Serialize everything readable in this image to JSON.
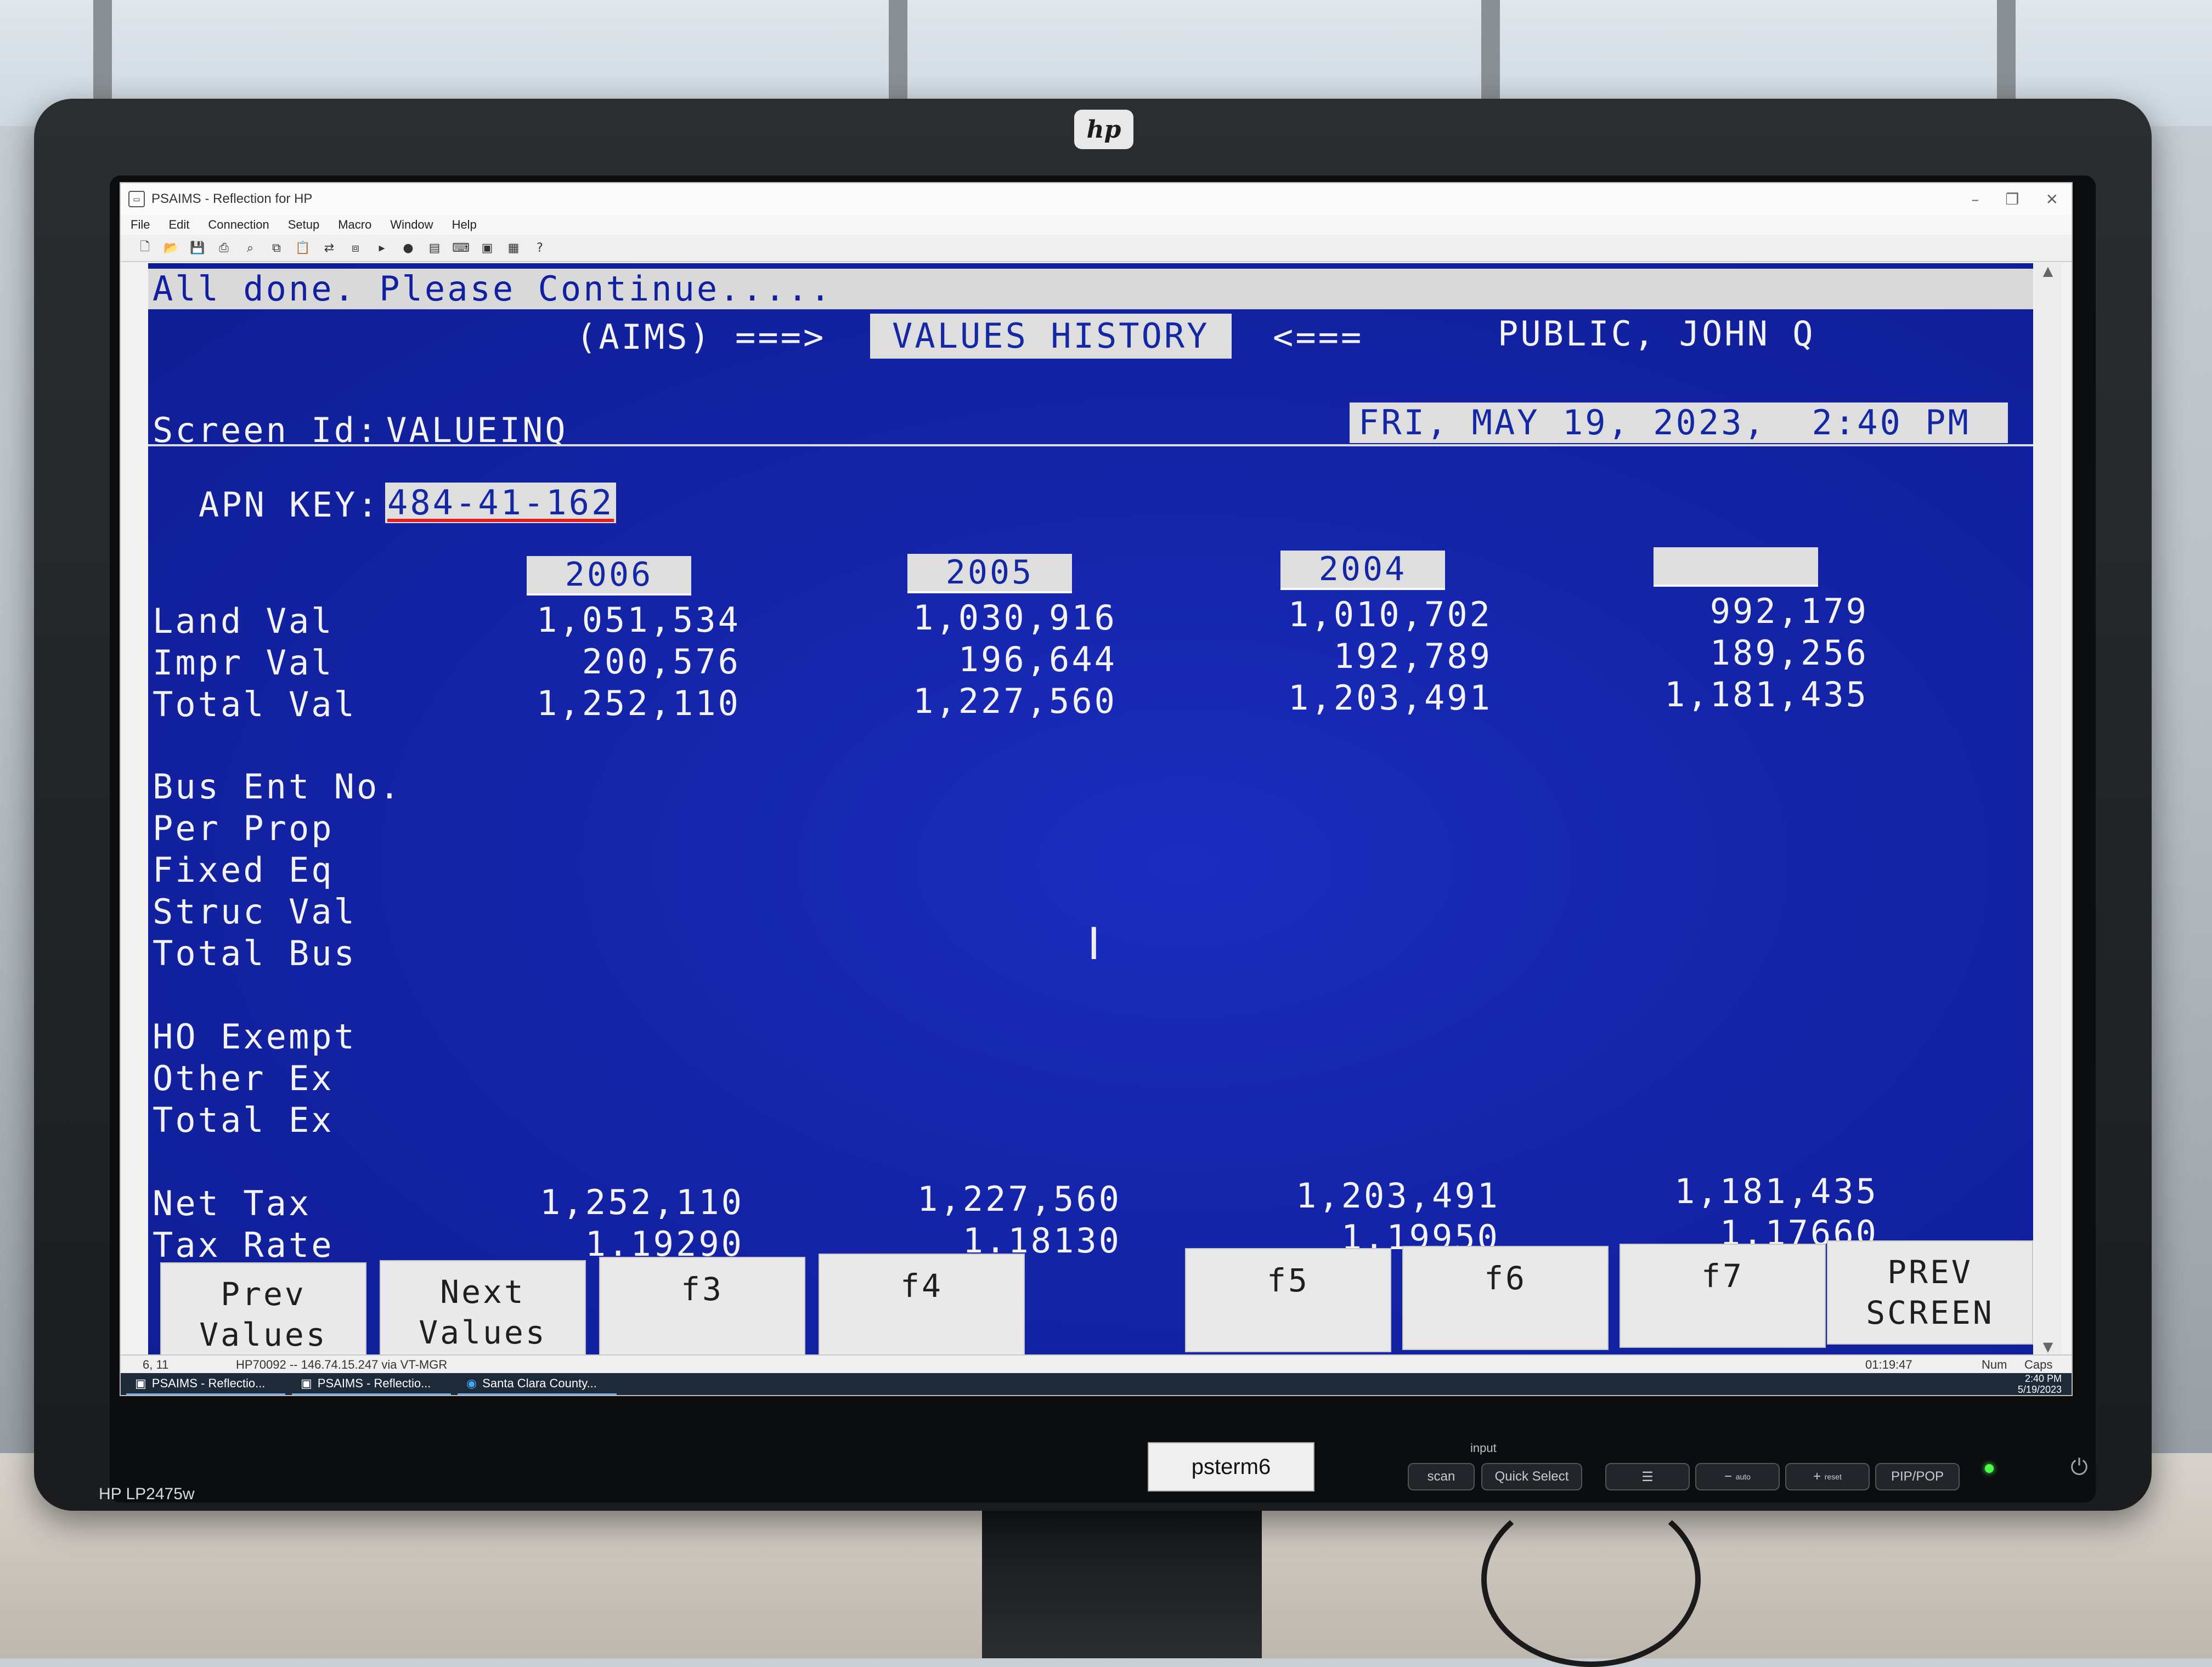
{
  "monitor": {
    "brand": "hp",
    "model": "HP LP2475w",
    "asset_tag": "psterm6",
    "osd": {
      "input_label": "input",
      "scan": "scan",
      "quick_select": "Quick Select",
      "menu": "☰",
      "minus": "−",
      "auto": "auto",
      "plus": "+",
      "reset": "reset",
      "pip": "PIP/POP",
      "power": "⏻"
    }
  },
  "window": {
    "title": "PSAIMS - Reflection for HP",
    "controls": {
      "minimize": "–",
      "restore": "❐",
      "close": "✕"
    },
    "menu": [
      "File",
      "Edit",
      "Connection",
      "Setup",
      "Macro",
      "Window",
      "Help"
    ]
  },
  "terminal": {
    "status_message": "All done.  Please Continue.....",
    "system": "(AIMS)",
    "arrow_right": "===>",
    "screen_title": "VALUES HISTORY",
    "arrow_left": "<===",
    "owner_name": "PUBLIC, JOHN Q",
    "screen_id_label": "Screen Id:",
    "screen_id": "VALUEINQ",
    "datetime": "FRI, MAY 19, 2023,  2:40 PM",
    "apn_label": "APN KEY:",
    "apn_value": "484-41-162",
    "years": [
      "2006",
      "2005",
      "2004",
      ""
    ],
    "rows": {
      "land_val": {
        "label": "Land Val",
        "values": [
          "1,051,534",
          "1,030,916",
          "1,010,702",
          "992,179"
        ]
      },
      "impr_val": {
        "label": "Impr Val",
        "values": [
          "200,576",
          "196,644",
          "192,789",
          "189,256"
        ]
      },
      "total_val": {
        "label": "Total Val",
        "values": [
          "1,252,110",
          "1,227,560",
          "1,203,491",
          "1,181,435"
        ]
      },
      "bus_ent_no": {
        "label": "Bus Ent No."
      },
      "per_prop": {
        "label": "Per Prop"
      },
      "fixed_eq": {
        "label": "Fixed Eq"
      },
      "struc_val": {
        "label": "Struc Val"
      },
      "total_bus": {
        "label": "Total Bus"
      },
      "ho_exempt": {
        "label": "HO Exempt"
      },
      "other_ex": {
        "label": "Other Ex"
      },
      "total_ex": {
        "label": "Total Ex"
      },
      "net_tax": {
        "label": "Net Tax",
        "values": [
          "1,252,110",
          "1,227,560",
          "1,203,491",
          "1,181,435"
        ]
      },
      "tax_rate": {
        "label": "Tax Rate",
        "values": [
          "1.19290",
          "1.18130",
          "1.19950",
          "1.17660"
        ]
      }
    },
    "function_keys": {
      "f1": {
        "line1": "Prev",
        "line2": "Values"
      },
      "f2": {
        "line1": "Next",
        "line2": "Values"
      },
      "f3": {
        "line1": "f3"
      },
      "f4": {
        "line1": "f4"
      },
      "f5": {
        "line1": "f5"
      },
      "f6": {
        "line1": "f6"
      },
      "f7": {
        "line1": "f7"
      },
      "f8": {
        "line1": "PREV",
        "line2": "SCREEN"
      }
    }
  },
  "statusbar": {
    "cursor": "6, 11",
    "connection": "HP70092 -- 146.74.15.247 via VT-MGR",
    "timer": "01:19:47",
    "num": "Num",
    "caps": "Caps"
  },
  "taskbar": {
    "items": [
      "PSAIMS - Reflectio...",
      "PSAIMS - Reflectio...",
      "Santa Clara County..."
    ],
    "time": "2:40 PM",
    "date": "5/19/2023"
  },
  "colors": {
    "terminal_bg": "#1424a8",
    "terminal_fg": "#f2f2f2",
    "reverse_bg": "#dedede",
    "reverse_fg": "#1428a5"
  }
}
